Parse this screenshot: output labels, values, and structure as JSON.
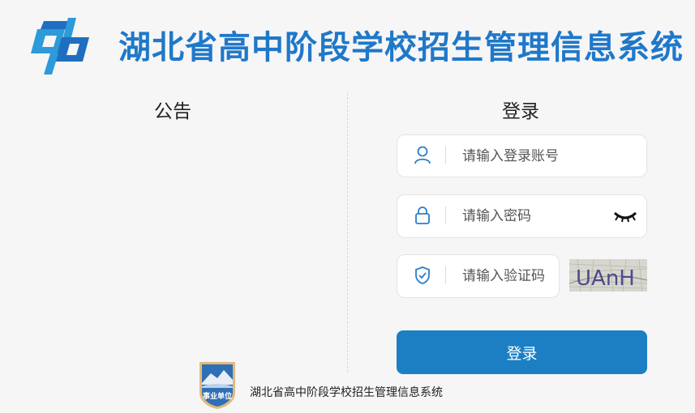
{
  "header": {
    "title": "湖北省高中阶段学校招生管理信息系统",
    "logo_icon": "cp-logo-icon",
    "brand_color": "#1f78c9"
  },
  "notice": {
    "title": "公告"
  },
  "login": {
    "title": "登录",
    "username": {
      "placeholder": "请输入登录账号",
      "icon": "user-icon"
    },
    "password": {
      "placeholder": "请输入密码",
      "icon": "lock-icon",
      "toggle_icon": "eye-closed-icon"
    },
    "captcha": {
      "placeholder": "请输入验证码",
      "icon": "shield-check-icon",
      "image_text": "UAnH"
    },
    "submit_label": "登录",
    "button_color": "#1c7fc4"
  },
  "footer": {
    "badge_text": "事业单位",
    "text": "湖北省高中阶段学校招生管理信息系统"
  }
}
